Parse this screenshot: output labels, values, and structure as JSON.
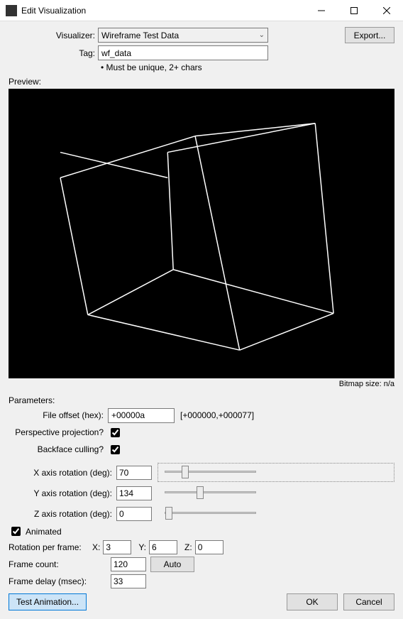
{
  "window": {
    "title": "Edit Visualization"
  },
  "toolbar": {
    "visualizer_label": "Visualizer:",
    "visualizer_value": "Wireframe Test Data",
    "export_label": "Export...",
    "tag_label": "Tag:",
    "tag_value": "wf_data",
    "tag_hint": "• Must be unique, 2+ chars"
  },
  "preview": {
    "label": "Preview:",
    "bitmap_size": "Bitmap size: n/a"
  },
  "parameters": {
    "heading": "Parameters:",
    "file_offset_label": "File offset (hex):",
    "file_offset_value": "+00000a",
    "file_offset_range": "[+000000,+000077]",
    "perspective_label": "Perspective projection?",
    "backface_label": "Backface culling?",
    "x_rot_label": "X axis rotation (deg):",
    "x_rot_value": "70",
    "y_rot_label": "Y axis rotation (deg):",
    "y_rot_value": "134",
    "z_rot_label": "Z axis rotation (deg):",
    "z_rot_value": "0",
    "animated_label": "Animated",
    "rot_per_frame_label": "Rotation per frame:",
    "rot_x_label": "X:",
    "rot_x_value": "3",
    "rot_y_label": "Y:",
    "rot_y_value": "6",
    "rot_z_label": "Z:",
    "rot_z_value": "0",
    "frame_count_label": "Frame count:",
    "frame_count_value": "120",
    "auto_label": "Auto",
    "frame_delay_label": "Frame delay (msec):",
    "frame_delay_value": "33"
  },
  "buttons": {
    "test_animation": "Test Animation...",
    "ok": "OK",
    "cancel": "Cancel"
  }
}
